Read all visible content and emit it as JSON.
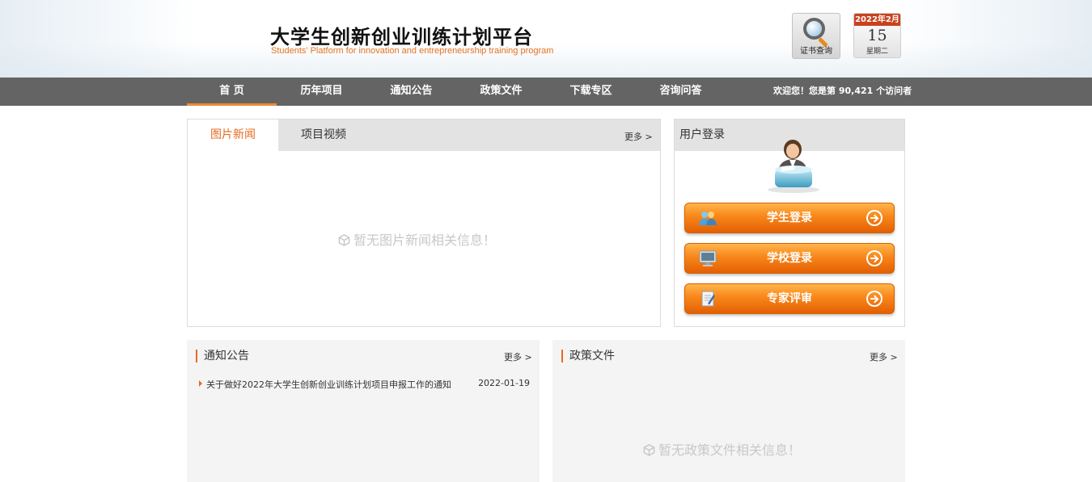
{
  "header": {
    "title": "大学生创新创业训练计划平台",
    "subtitle": "Students' Platform for innovation and entrepreneurship training program",
    "cert_label": "证书查询",
    "calendar": {
      "month": "2022年2月",
      "day": "15",
      "weekday": "星期二"
    }
  },
  "nav": {
    "items": [
      {
        "label": "首 页"
      },
      {
        "label": "历年项目"
      },
      {
        "label": "通知公告"
      },
      {
        "label": "政策文件"
      },
      {
        "label": "下载专区"
      },
      {
        "label": "咨询问答"
      }
    ],
    "visitor_text": "欢迎您！您是第 90,421 个访问者"
  },
  "news": {
    "tabs": [
      {
        "label": "图片新闻"
      },
      {
        "label": "项目视频"
      }
    ],
    "more": "更多 >",
    "empty": "暂无图片新闻相关信息！"
  },
  "login": {
    "title": "用户登录",
    "buttons": [
      {
        "label": "学生登录"
      },
      {
        "label": "学校登录"
      },
      {
        "label": "专家评审"
      }
    ]
  },
  "notice": {
    "title": "通知公告",
    "more": "更多 >",
    "items": [
      {
        "title": "关于做好2022年大学生创新创业训练计划项目申报工作的通知",
        "date": "2022-01-19"
      }
    ]
  },
  "policy": {
    "title": "政策文件",
    "more": "更多 >",
    "empty": "暂无政策文件相关信息！"
  },
  "colors": {
    "accent": "#e66b1f",
    "nav_bg": "#646464",
    "button": "#f8861a",
    "calendar_red": "#c9421c"
  }
}
